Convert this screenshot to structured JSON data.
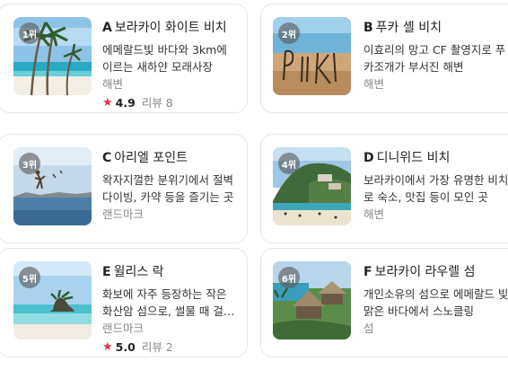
{
  "places": [
    {
      "rank": "1위",
      "letter": "A",
      "name": "보라카이 화이트 비치",
      "desc": "에메랄드빛 바다와 3km에 이르는 새하얀 모래사장",
      "category": "해변",
      "rating": "4.9",
      "reviews": "리뷰 8"
    },
    {
      "rank": "2위",
      "letter": "B",
      "name": "푸카 셸 비치",
      "desc": "이효리의 망고 CF 촬영지로 푸카조개가 부서진 해변",
      "category": "해변"
    },
    {
      "rank": "3위",
      "letter": "C",
      "name": "아리엘 포인트",
      "desc": "왁자지껄한 분위기에서 절벽 다이빙, 카약 등을 즐기는 곳",
      "category": "랜드마크"
    },
    {
      "rank": "4위",
      "letter": "D",
      "name": "디니위드 비치",
      "desc": "보라카이에서 가장 유명한 비치로 숙소, 맛집 등이 모인 곳",
      "category": "해변"
    },
    {
      "rank": "5위",
      "letter": "E",
      "name": "윌리스 락",
      "desc": "화보에 자주 등장하는 작은 화산암 섬으로, 썰물 때 걸어갈 수 있는 곳",
      "category": "랜드마크",
      "rating": "5.0",
      "reviews": "리뷰 2"
    },
    {
      "rank": "6위",
      "letter": "F",
      "name": "보라카이 라우렐 섬",
      "desc": "개인소유의 섬으로 에메랄드 빛 맑은 바다에서 스노클링",
      "category": "섬"
    }
  ],
  "colors": {
    "star": "#e8343f",
    "rank_badge": "rgba(90,90,90,0.62)"
  },
  "icons": {
    "rating": "star-icon"
  }
}
